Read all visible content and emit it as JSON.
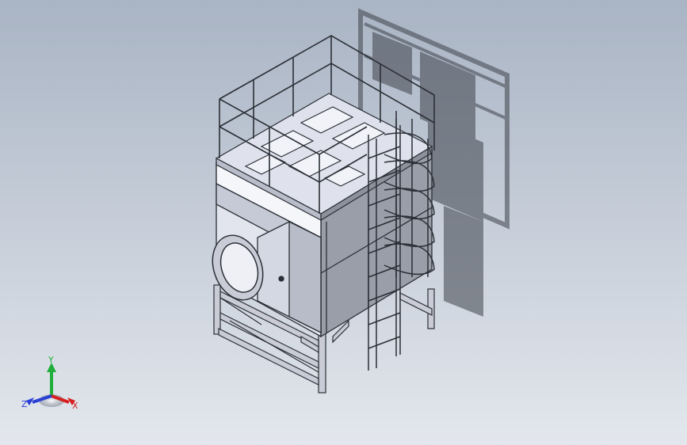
{
  "viewport": {
    "background_top": "#a9b4c4",
    "background_bottom": "#e3e7ed"
  },
  "model": {
    "kind": "3d-assembly",
    "parts": [
      "housing",
      "top-platform",
      "guard-railing",
      "caged-ladder",
      "inlet-flange",
      "inlet-hood",
      "support-frame",
      "access-hatches"
    ],
    "edge_color": "#2b2f36",
    "face_light": "#eef0f5",
    "face_mid": "#c9ccd6",
    "face_dark": "#8f939e",
    "shadow_color": "#4a4f57"
  },
  "triad": {
    "y_label": "Y",
    "x_label": "X",
    "z_label": "Z",
    "y_color": "#1fae3a",
    "x_color": "#d62020",
    "z_color": "#2a3fd6"
  }
}
